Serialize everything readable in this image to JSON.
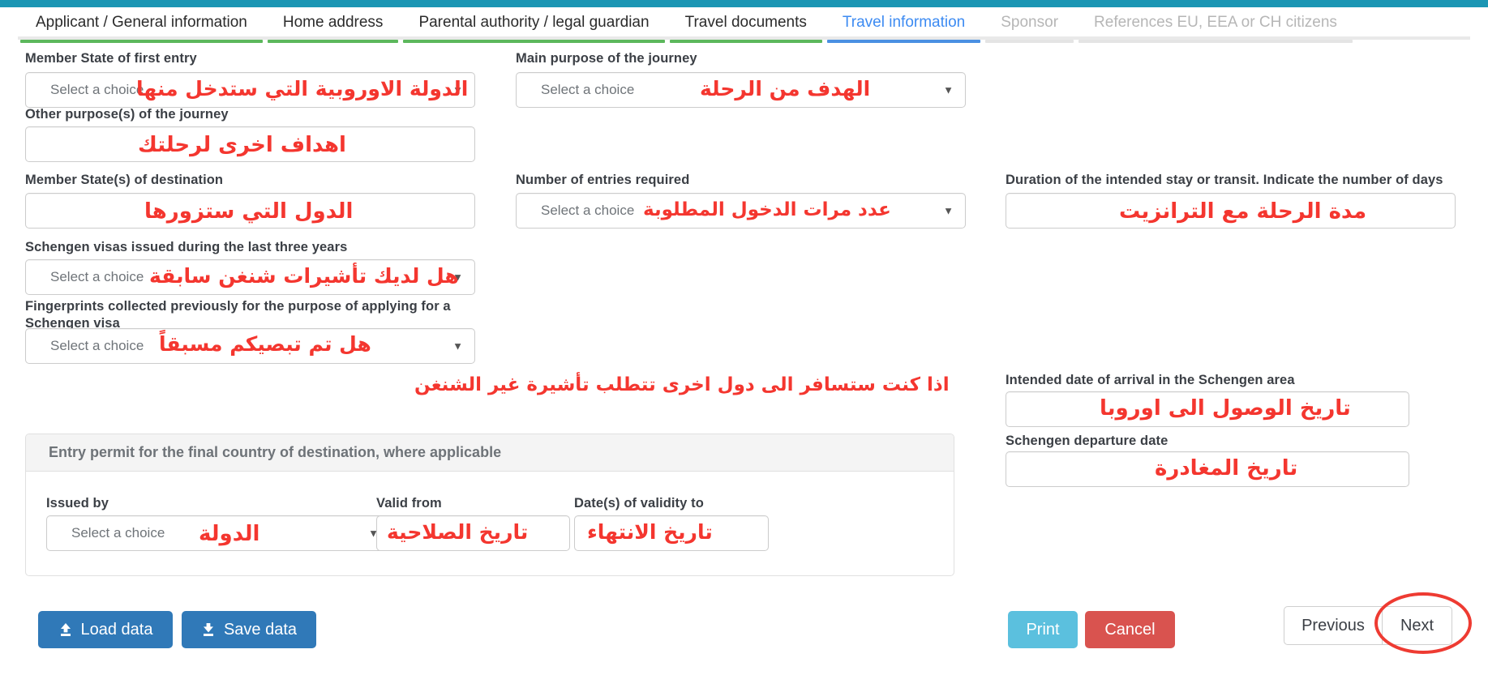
{
  "tabs": [
    {
      "label": "Applicant / General information",
      "state": "done"
    },
    {
      "label": "Home address",
      "state": "done"
    },
    {
      "label": "Parental authority / legal guardian",
      "state": "done"
    },
    {
      "label": "Travel documents",
      "state": "done"
    },
    {
      "label": "Travel information",
      "state": "active"
    },
    {
      "label": "Sponsor",
      "state": "disabled"
    },
    {
      "label": "References EU, EEA or CH citizens",
      "state": "disabled"
    }
  ],
  "placeholder": "Select a choice",
  "fields": {
    "member_state_first_entry": {
      "label": "Member State of first entry",
      "value": "Select a choice",
      "annotation": "الدولة الاوروبية التي ستدخل منها"
    },
    "main_purpose": {
      "label": "Main purpose of the journey",
      "value": "Select a choice",
      "annotation": "الهدف من الرحلة"
    },
    "other_purpose": {
      "label": "Other purpose(s) of the journey",
      "value": "",
      "annotation": "اهداف اخرى لرحلتك"
    },
    "member_states_destination": {
      "label": "Member State(s) of destination",
      "value": "",
      "annotation": "الدول التي ستزورها"
    },
    "number_of_entries": {
      "label": "Number of entries required",
      "value": "Select a choice",
      "annotation": "عدد مرات الدخول المطلوبة"
    },
    "duration_of_stay": {
      "label": "Duration of the intended stay or transit. Indicate the number of days",
      "value": "",
      "annotation": "مدة الرحلة مع الترانزيت"
    },
    "schengen_visas_last_three_years": {
      "label": "Schengen visas issued during the last three years",
      "value": "Select a choice",
      "annotation": "هل لديك تأشيرات شنغن سابقة"
    },
    "fingerprints_collected": {
      "label": "Fingerprints collected previously for the purpose of applying for a Schengen visa",
      "value": "Select a choice",
      "annotation": "هل تم تبصيكم مسبقاً"
    },
    "intended_arrival_date": {
      "label": "Intended date of arrival in the Schengen area",
      "value": "",
      "annotation": "تاريخ الوصول الى اوروبا"
    },
    "schengen_departure_date": {
      "label": "Schengen departure date",
      "value": "",
      "annotation": "تاريخ المغادرة"
    }
  },
  "entry_permit_panel": {
    "title": "Entry permit for the final country of destination, where applicable",
    "annotation": "اذا كنت ستسافر الى دول اخرى تتطلب تأشيرة غير الشنغن",
    "issued_by": {
      "label": "Issued by",
      "value": "Select a choice",
      "annotation": "الدولة"
    },
    "valid_from": {
      "label": "Valid from",
      "value": "",
      "annotation": "تاريخ الصلاحية"
    },
    "valid_to": {
      "label": "Date(s) of validity to",
      "value": "",
      "annotation": "تاريخ الانتهاء"
    }
  },
  "buttons": {
    "load_data": "Load data",
    "save_data": "Save data",
    "print": "Print",
    "cancel": "Cancel",
    "previous": "Previous",
    "next": "Next"
  },
  "colors": {
    "topbar": "#1b96b4",
    "tab_done": "#5cb85c",
    "tab_active": "#4a90e2",
    "annotation": "#f4362f",
    "primary": "#3079b8",
    "print": "#5bc0de",
    "cancel": "#d9534f"
  }
}
